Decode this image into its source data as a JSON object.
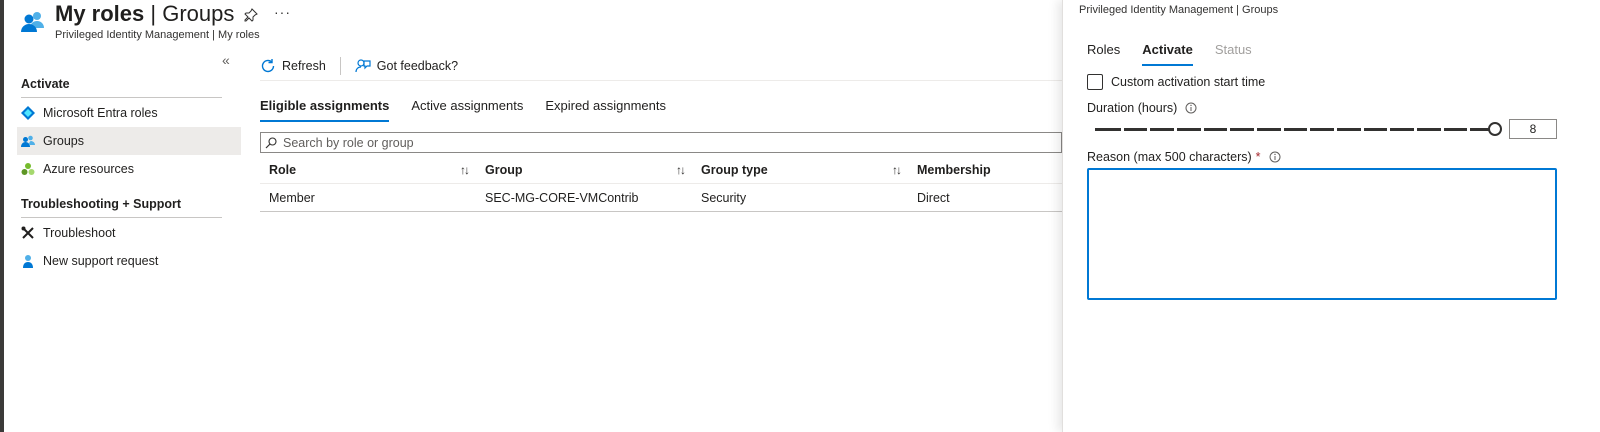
{
  "header": {
    "title_bold": "My roles",
    "title_rest": " | Groups",
    "subtitle": "Privileged Identity Management | My roles",
    "more": "···"
  },
  "sidebar": {
    "collapse": "«",
    "sections": [
      {
        "title": "Activate",
        "items": [
          {
            "label": "Microsoft Entra roles",
            "icon": "entra-diamond-icon"
          },
          {
            "label": "Groups",
            "icon": "groups-icon",
            "selected": true
          },
          {
            "label": "Azure resources",
            "icon": "azure-resources-icon"
          }
        ]
      },
      {
        "title": "Troubleshooting + Support",
        "items": [
          {
            "label": "Troubleshoot",
            "icon": "tools-icon"
          },
          {
            "label": "New support request",
            "icon": "support-person-icon"
          }
        ]
      }
    ]
  },
  "toolbar": {
    "refresh_label": "Refresh",
    "feedback_label": "Got feedback?"
  },
  "tabs": [
    "Eligible assignments",
    "Active assignments",
    "Expired assignments"
  ],
  "search": {
    "placeholder": "Search by role or group",
    "value": ""
  },
  "table": {
    "columns": [
      "Role",
      "Group",
      "Group type",
      "Membership"
    ],
    "sort_glyph": "↑↓",
    "rows": [
      [
        "Member",
        "SEC-MG-CORE-VMContrib",
        "Security",
        "Direct"
      ]
    ]
  },
  "panel": {
    "breadcrumb": "Privileged Identity Management | Groups",
    "tabs": [
      "Roles",
      "Activate",
      "Status"
    ],
    "active_tab": "Activate",
    "custom_start_label": "Custom activation start time",
    "custom_start_checked": false,
    "duration_label": "Duration (hours)",
    "duration_value": "8",
    "duration_fraction": 1.0,
    "reason_label": "Reason (max 500 characters)",
    "required_mark": "*",
    "reason_value": ""
  },
  "colors": {
    "accent": "#0078d4",
    "selected_nav": "#edebe9",
    "required": "#a4262c"
  }
}
